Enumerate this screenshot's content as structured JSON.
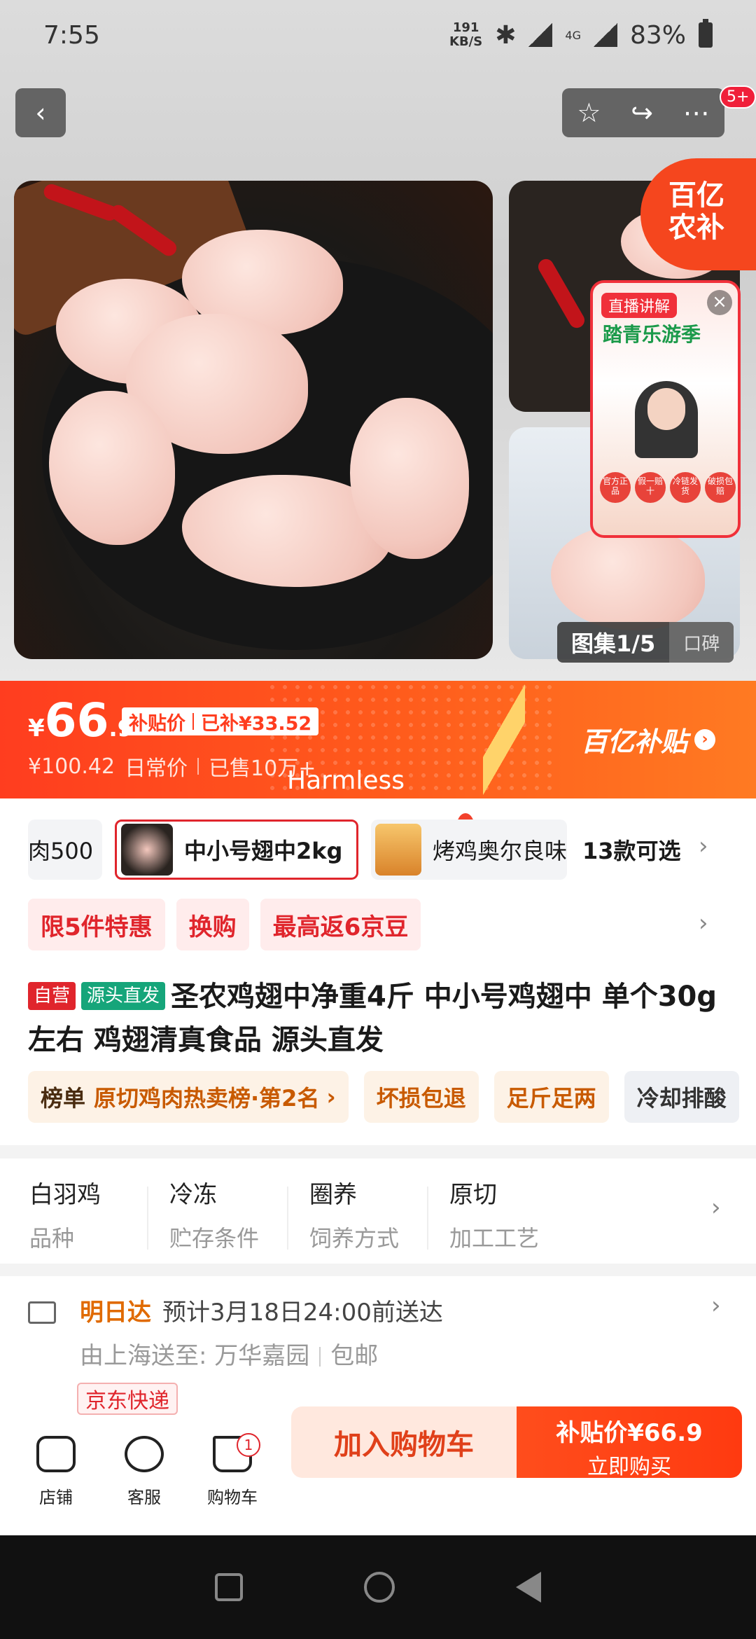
{
  "status_bar": {
    "time": "7:55",
    "speed_value": "191",
    "speed_unit": "KB/S",
    "network": "4G",
    "battery": "83%"
  },
  "header": {
    "notification_badge": "5+"
  },
  "gallery": {
    "counter": "图集1/5",
    "word_of_mouth": "口碑",
    "corner_brand": [
      "百亿",
      "农补"
    ]
  },
  "live_overlay": {
    "tag": "直播讲解",
    "title": "踏青乐游季",
    "chips": [
      "官方正品",
      "假一赔十",
      "冷链发货",
      "破损包赔"
    ]
  },
  "price_banner": {
    "currency": "¥",
    "price_int": "66",
    "price_dec": ".9",
    "subsidy_label": "补贴价",
    "subsidy_amount": "已补¥33.52",
    "original_price": "¥100.42",
    "original_label": "日常价",
    "sold": "已售10万+",
    "overlay_text": "Harmless",
    "brand": "百亿补贴"
  },
  "variants": {
    "items": [
      {
        "label": "肉500"
      },
      {
        "label": "中小号翅中2kg",
        "selected": true
      },
      {
        "label": "烤鸡奥尔良味"
      }
    ],
    "count": "13款可选"
  },
  "promos": [
    "限5件特惠",
    "换购",
    "最高返6京豆"
  ],
  "product": {
    "tag_self": "自营",
    "tag_source": "源头直发",
    "title": "圣农鸡翅中净重4斤 中小号鸡翅中 单个30g左右 鸡翅清真食品 源头直发"
  },
  "rank_chips": [
    {
      "key": "榜单",
      "value": "原切鸡肉热卖榜·第2名"
    },
    {
      "value": "坏损包退"
    },
    {
      "value": "足斤足两"
    },
    {
      "value": "冷却排酸"
    }
  ],
  "attributes": [
    {
      "value": "白羽鸡",
      "key": "品种"
    },
    {
      "value": "冷冻",
      "key": "贮存条件"
    },
    {
      "value": "圈养",
      "key": "饲养方式"
    },
    {
      "value": "原切",
      "key": "加工工艺"
    }
  ],
  "delivery": {
    "speed": "明日达",
    "eta": "预计3月18日24:00前送达",
    "from": "由上海送至:",
    "to": "万华嘉园",
    "shipping": "包邮",
    "carrier": "京东快递"
  },
  "bottom_bar": {
    "store": "店铺",
    "service": "客服",
    "cart": "购物车",
    "cart_count": "1",
    "add_to_cart": "加入购物车",
    "buy_price": "补贴价¥66.9",
    "buy_now": "立即购买"
  },
  "colors": {
    "accent": "#ff3d1f",
    "promo_red": "#e0252c",
    "rank_brown": "#c85a00"
  }
}
